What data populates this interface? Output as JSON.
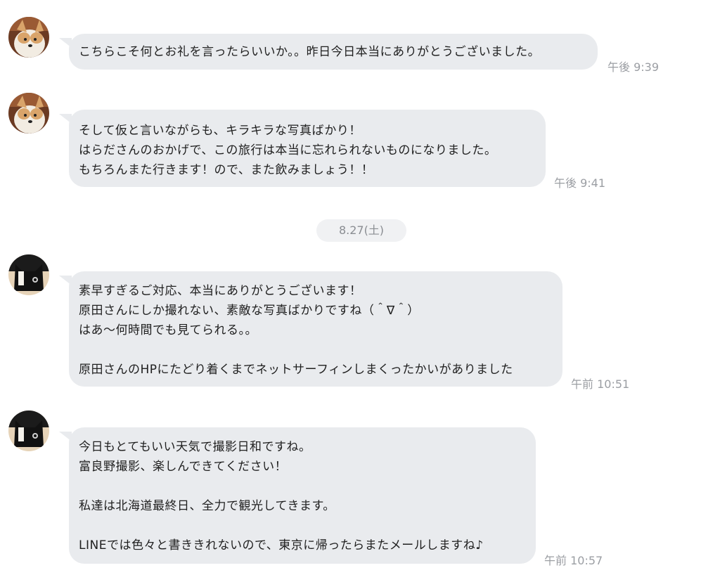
{
  "messages": [
    {
      "sender": "corgi",
      "avatar_icon": "corgi-avatar-icon",
      "text": "こちらこそ何とお礼を言ったらいいか。。昨日今日本当にありがとうございました。",
      "time": "午後 9:39"
    },
    {
      "sender": "corgi",
      "avatar_icon": "corgi-avatar-icon",
      "text": "そして仮と言いながらも、キラキラな写真ばかり！\nはらださんのおかげで、この旅行は本当に忘れられないものになりました。\nもちろんまた行きます！ので、また飲みましょう！！",
      "time": "午後 9:41"
    },
    {
      "sender": "cat",
      "avatar_icon": "black-cat-avatar-icon",
      "text": "素早すぎるご対応、本当にありがとうございます！\n原田さんにしか撮れない、素敵な写真ばかりですね（＾∇＾）\nはあ〜何時間でも見てられる。。\n\n原田さんのHPにたどり着くまでネットサーフィンしまくったかいがありました",
      "time": "午前 10:51"
    },
    {
      "sender": "cat",
      "avatar_icon": "black-cat-avatar-icon",
      "text": "今日もとてもいい天気で撮影日和ですね。\n富良野撮影、楽しんできてください！\n\n私達は北海道最終日、全力で観光してきます。\n\nLINEでは色々と書ききれないので、東京に帰ったらまたメールしますね♪",
      "time": "午前 10:57"
    }
  ],
  "date_separator": "8.27(土)",
  "colors": {
    "bubble": "#e9ebee",
    "timestamp": "#9b9ea3",
    "date_pill": "#f0f1f3"
  }
}
